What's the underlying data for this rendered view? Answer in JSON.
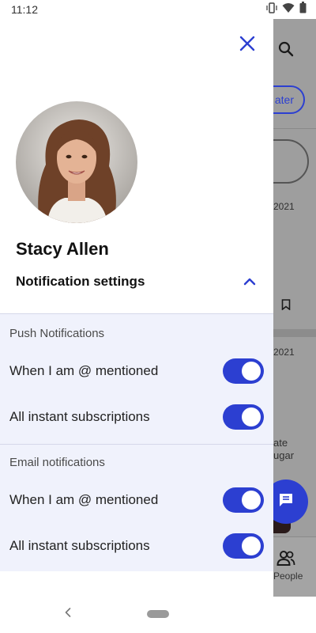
{
  "status_bar": {
    "time": "11:12"
  },
  "background": {
    "pill_label": "ater",
    "date_1": "2021",
    "date_2": "2021",
    "text_line_1": "ate",
    "text_line_2": "ugar",
    "nav_people_label": "People"
  },
  "drawer": {
    "user_name": "Stacy Allen",
    "notification_settings_title": "Notification settings",
    "push_section": {
      "title": "Push Notifications",
      "items": [
        {
          "label": "When I am @ mentioned",
          "enabled": true
        },
        {
          "label": "All instant subscriptions",
          "enabled": true
        }
      ]
    },
    "email_section": {
      "title": "Email notifications",
      "items": [
        {
          "label": "When I am @ mentioned",
          "enabled": true
        },
        {
          "label": "All instant subscriptions",
          "enabled": true
        }
      ]
    }
  },
  "colors": {
    "accent": "#2c3fd1",
    "panel_bg": "#f0f2fc",
    "scrim": "#9e9e9e"
  },
  "icons": [
    "close-icon",
    "chevron-up-icon",
    "search-icon",
    "bookmark-icon",
    "chat-icon",
    "people-icon",
    "back-icon",
    "wifi-icon",
    "battery-icon",
    "vibrate-icon"
  ]
}
